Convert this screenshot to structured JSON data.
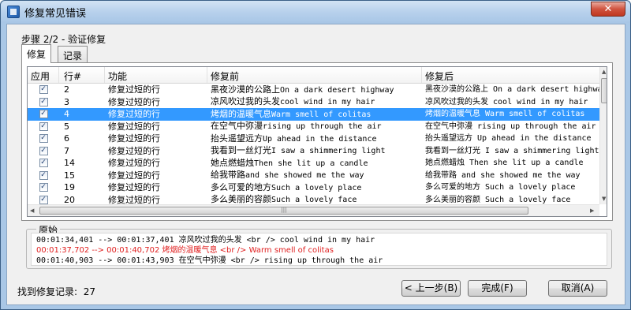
{
  "window": {
    "title": "修复常见错误",
    "close_glyph": "✕"
  },
  "step": "步骤 2/2 - 验证修复",
  "tabs": [
    {
      "label": "修复",
      "active": true
    },
    {
      "label": "记录",
      "active": false
    }
  ],
  "grid": {
    "columns": [
      "应用",
      "行#",
      "功能",
      "修复前",
      "修复后"
    ],
    "rows": [
      {
        "apply": true,
        "line": "2",
        "func": "修复过短的行",
        "before_cn": "黑夜沙漠的公路上",
        "before_en": "On a dark desert highway",
        "after": "黑夜沙漠的公路上 On a dark desert highway",
        "selected": false
      },
      {
        "apply": true,
        "line": "3",
        "func": "修复过短的行",
        "before_cn": "凉风吹过我的头发",
        "before_en": "cool wind in my hair",
        "after": "凉风吹过我的头发 cool wind in my hair",
        "selected": false
      },
      {
        "apply": true,
        "line": "4",
        "func": "修复过短的行",
        "before_cn": "烤烟的温暖气息",
        "before_en": "Warm smell of colitas",
        "after": "烤烟的温暖气息 Warm smell of colitas",
        "selected": true
      },
      {
        "apply": true,
        "line": "5",
        "func": "修复过短的行",
        "before_cn": "在空气中弥漫",
        "before_en": "rising up through the air",
        "after": "在空气中弥漫 rising up through the air",
        "selected": false
      },
      {
        "apply": true,
        "line": "6",
        "func": "修复过短的行",
        "before_cn": "抬头遥望远方",
        "before_en": "Up ahead in the distance",
        "after": "抬头遥望远方 Up ahead in the distance",
        "selected": false
      },
      {
        "apply": true,
        "line": "7",
        "func": "修复过短的行",
        "before_cn": "我看到一丝灯光",
        "before_en": "I saw a shimmering light",
        "after": "我看到一丝灯光 I saw a shimmering light",
        "selected": false
      },
      {
        "apply": true,
        "line": "14",
        "func": "修复过短的行",
        "before_cn": "她点燃蜡烛",
        "before_en": "Then she lit up a candle",
        "after": "她点燃蜡烛 Then she lit up a candle",
        "selected": false
      },
      {
        "apply": true,
        "line": "15",
        "func": "修复过短的行",
        "before_cn": "给我带路",
        "before_en": "and she showed me the way",
        "after": "给我带路 and she showed me the way",
        "selected": false
      },
      {
        "apply": true,
        "line": "19",
        "func": "修复过短的行",
        "before_cn": "多么可爱的地方",
        "before_en": "Such a lovely place",
        "after": "多么可爱的地方 Such a lovely place",
        "selected": false
      },
      {
        "apply": true,
        "line": "20",
        "func": "修复过短的行",
        "before_cn": "多么美丽的容颜",
        "before_en": "Such a lovely face",
        "after": "多么美丽的容颜 Such a lovely face",
        "selected": false
      }
    ]
  },
  "original": {
    "legend": "原始",
    "lines": [
      {
        "text": "00:01:34,401 --> 00:01:37,401 凉风吹过我的头发 <br /> cool wind in my hair",
        "highlight": false
      },
      {
        "text": "00:01:37,702 --> 00:01:40,702 烤烟的温暖气息 <br /> Warm smell of colitas",
        "highlight": true
      },
      {
        "text": "00:01:40,903 --> 00:01:43,903 在空气中弥漫 <br /> rising up through the air",
        "highlight": false
      }
    ]
  },
  "found": {
    "label": "找到修复记录:",
    "count": "27"
  },
  "buttons": {
    "back": "< 上一步(B)",
    "finish": "完成(F)",
    "cancel": "取消(A)"
  },
  "colors": {
    "selection": "#3399ff",
    "highlight_text": "#e02020"
  }
}
